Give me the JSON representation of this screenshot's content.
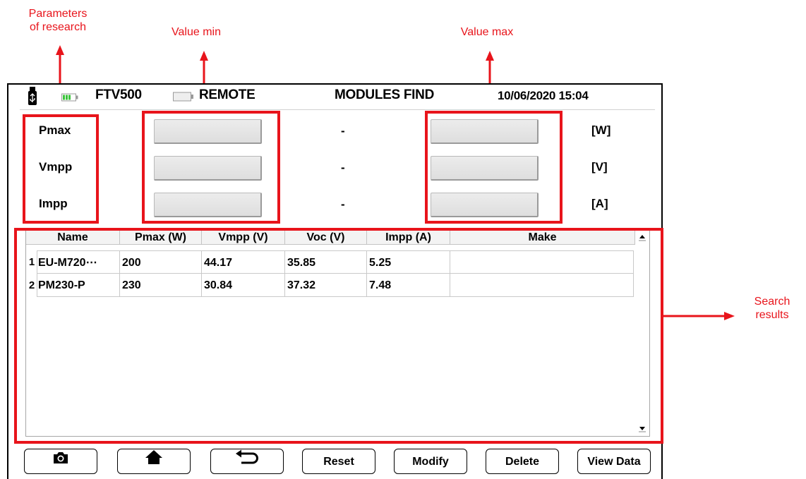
{
  "annotations": {
    "parameters": "Parameters\nof research",
    "value_min": "Value min",
    "value_max": "Value max",
    "search_results": "Search\nresults"
  },
  "status_bar": {
    "device": "FTV500",
    "mode": "REMOTE",
    "title": "MODULES FIND",
    "datetime": "10/06/2020 15:04"
  },
  "params": [
    {
      "label": "Pmax",
      "min": "",
      "separator": "-",
      "max": "",
      "unit": "[W]"
    },
    {
      "label": "Vmpp",
      "min": "",
      "separator": "-",
      "max": "",
      "unit": "[V]"
    },
    {
      "label": "Impp",
      "min": "",
      "separator": "-",
      "max": "",
      "unit": "[A]"
    }
  ],
  "table": {
    "columns": [
      "Name",
      "Pmax (W)",
      "Vmpp (V)",
      "Voc (V)",
      "Impp (A)",
      "Make"
    ],
    "rows": [
      {
        "num": "1",
        "cells": [
          "EU-M720⋯",
          "200",
          "44.17",
          "35.85",
          "5.25",
          ""
        ]
      },
      {
        "num": "2",
        "cells": [
          "PM230-P",
          "230",
          "30.84",
          "37.32",
          "7.48",
          ""
        ]
      }
    ]
  },
  "buttons": {
    "camera": "camera-icon",
    "home": "home-icon",
    "back": "back-arrow-icon",
    "reset": "Reset",
    "modify": "Modify",
    "delete": "Delete",
    "view_data": "View Data"
  },
  "colors": {
    "annotation": "#e8141b",
    "battery_green": "#3cc43c"
  }
}
